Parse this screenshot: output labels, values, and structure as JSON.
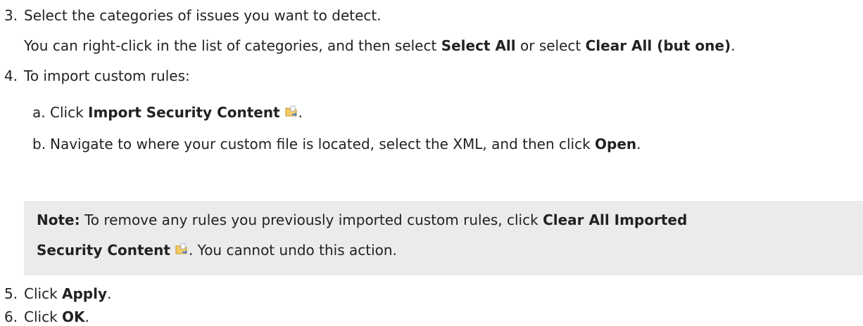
{
  "steps": {
    "step3": {
      "number": "3.",
      "text": "Select the categories of issues you want to detect.",
      "detail_prefix": "You can right-click in the list of categories, and then select ",
      "detail_bold1": "Select All",
      "detail_mid": " or select ",
      "detail_bold2": "Clear All (but one)",
      "detail_suffix": "."
    },
    "step4": {
      "number": "4.",
      "text": "To import custom rules:",
      "sub_a": {
        "letter": "a.",
        "prefix": "Click ",
        "bold": "Import Security Content",
        "suffix": ".",
        "icon": "import-security-content-icon"
      },
      "sub_b": {
        "letter": "b.",
        "prefix": "Navigate to where your custom file is located, select the XML, and then click ",
        "bold": "Open",
        "suffix": "."
      },
      "note": {
        "label": "Note:",
        "prefix": " To remove any rules you previously imported custom rules, click ",
        "bold_line1": "Clear All Imported",
        "bold_line2": "Security Content",
        "suffix": ". You cannot undo this action.",
        "icon": "clear-imported-security-content-icon"
      }
    },
    "step5": {
      "number": "5.",
      "prefix": "Click ",
      "bold": "Apply",
      "suffix": "."
    },
    "step6": {
      "number": "6.",
      "prefix": "Click ",
      "bold": "OK",
      "suffix": "."
    }
  },
  "colors": {
    "text": "#222222",
    "note_background": "#ebebeb",
    "icon_folder": "#e8b23a",
    "icon_arrow": "#4a86c8"
  }
}
